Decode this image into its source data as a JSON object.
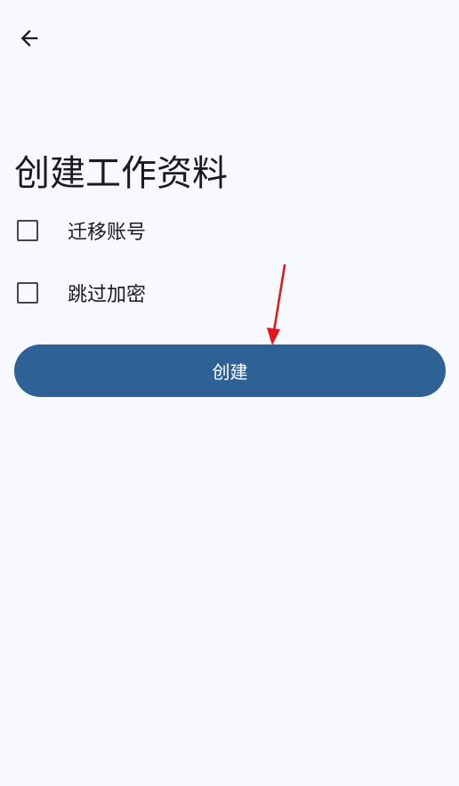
{
  "header": {
    "back_icon": "arrow-back-icon"
  },
  "page": {
    "title": "创建工作资料"
  },
  "options": [
    {
      "label": "迁移账号",
      "checked": false
    },
    {
      "label": "跳过加密",
      "checked": false
    }
  ],
  "actions": {
    "create_label": "创建"
  },
  "colors": {
    "background": "#f8f9ff",
    "primary": "#2e6297",
    "annotation_arrow": "#e5141b"
  }
}
